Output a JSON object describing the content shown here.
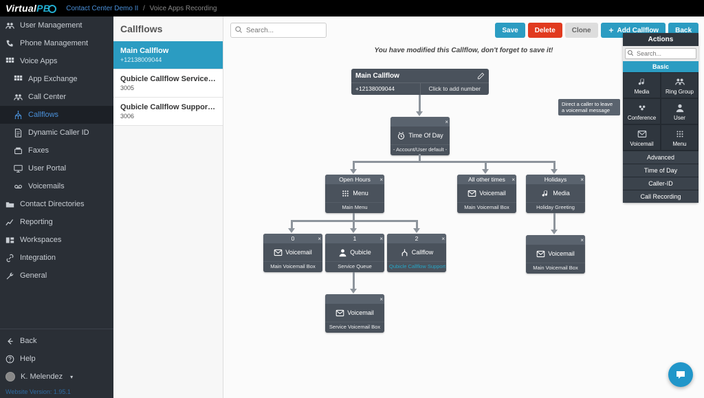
{
  "logo_prefix": "Virtual",
  "logo_suffix": "PB",
  "breadcrumb_link": "Contact Center Demo II",
  "breadcrumb_current": "Voice Apps Recording",
  "sidebar": [
    {
      "label": "User Management",
      "icon": "users"
    },
    {
      "label": "Phone Management",
      "icon": "phone"
    },
    {
      "label": "Voice Apps",
      "icon": "grid",
      "expanded": true,
      "children": [
        {
          "label": "App Exchange",
          "icon": "grid"
        },
        {
          "label": "Call Center",
          "icon": "users"
        },
        {
          "label": "Callflows",
          "icon": "flow",
          "active": true
        },
        {
          "label": "Dynamic Caller ID",
          "icon": "doc"
        },
        {
          "label": "Faxes",
          "icon": "fax"
        },
        {
          "label": "User Portal",
          "icon": "monitor"
        },
        {
          "label": "Voicemails",
          "icon": "vm"
        }
      ]
    },
    {
      "label": "Contact Directories",
      "icon": "folder"
    },
    {
      "label": "Reporting",
      "icon": "chart"
    },
    {
      "label": "Workspaces",
      "icon": "ws"
    },
    {
      "label": "Integration",
      "icon": "link"
    },
    {
      "label": "General",
      "icon": "wrench"
    }
  ],
  "back_label": "Back",
  "help_label": "Help",
  "user_name": "K. Melendez",
  "version": "Website Version: 1.95.1",
  "callflows_heading": "Callflows",
  "callflows": [
    {
      "name": "Main Callflow",
      "num": "+12138009044",
      "selected": true
    },
    {
      "name": "Qubicle Callflow Service Qu...",
      "num": "3005"
    },
    {
      "name": "Qubicle Callflow Support Qu...",
      "num": "3006"
    }
  ],
  "search_placeholder": "Search...",
  "buttons": {
    "save": "Save",
    "delete": "Delete",
    "clone": "Clone",
    "add": "Add Callflow",
    "back": "Back"
  },
  "notice": "You have modified this Callflow, don't forget to save it!",
  "root": {
    "title": "Main Callflow",
    "phone": "+12138009044",
    "add": "Click to add number"
  },
  "nodes": {
    "tod": {
      "label": "Time Of Day",
      "foot": "- Account/User default -"
    },
    "menu": {
      "hdr": "Open Hours",
      "label": "Menu",
      "foot": "Main Menu"
    },
    "vm1": {
      "hdr": "All other times",
      "label": "Voicemail",
      "foot": "Main Voicemail Box"
    },
    "media": {
      "hdr": "Holidays",
      "label": "Media",
      "foot": "Holiday Greeting"
    },
    "vm0": {
      "hdr": "0",
      "label": "Voicemail",
      "foot": "Main Voicemail Box"
    },
    "qub": {
      "hdr": "1",
      "label": "Qubicle",
      "foot": "Service Queue"
    },
    "cf": {
      "hdr": "2",
      "label": "Callflow",
      "foot": "Qubicle Callflow Support Queue"
    },
    "vmH": {
      "label": "Voicemail",
      "foot": "Main Voicemail Box"
    },
    "vmS": {
      "label": "Voicemail",
      "foot": "Service Voicemail Box"
    }
  },
  "actions": {
    "title": "Actions",
    "search": "Search...",
    "section": "Basic",
    "grid": [
      {
        "label": "Media",
        "icon": "note"
      },
      {
        "label": "Ring Group",
        "icon": "users"
      },
      {
        "label": "Conference",
        "icon": "conf"
      },
      {
        "label": "User",
        "icon": "user"
      },
      {
        "label": "Voicemail",
        "icon": "mail"
      },
      {
        "label": "Menu",
        "icon": "menu"
      }
    ],
    "rows": [
      "Advanced",
      "Time of Day",
      "Caller-ID",
      "Call Recording"
    ]
  },
  "tooltip": "Direct a caller to leave a voicemail message"
}
